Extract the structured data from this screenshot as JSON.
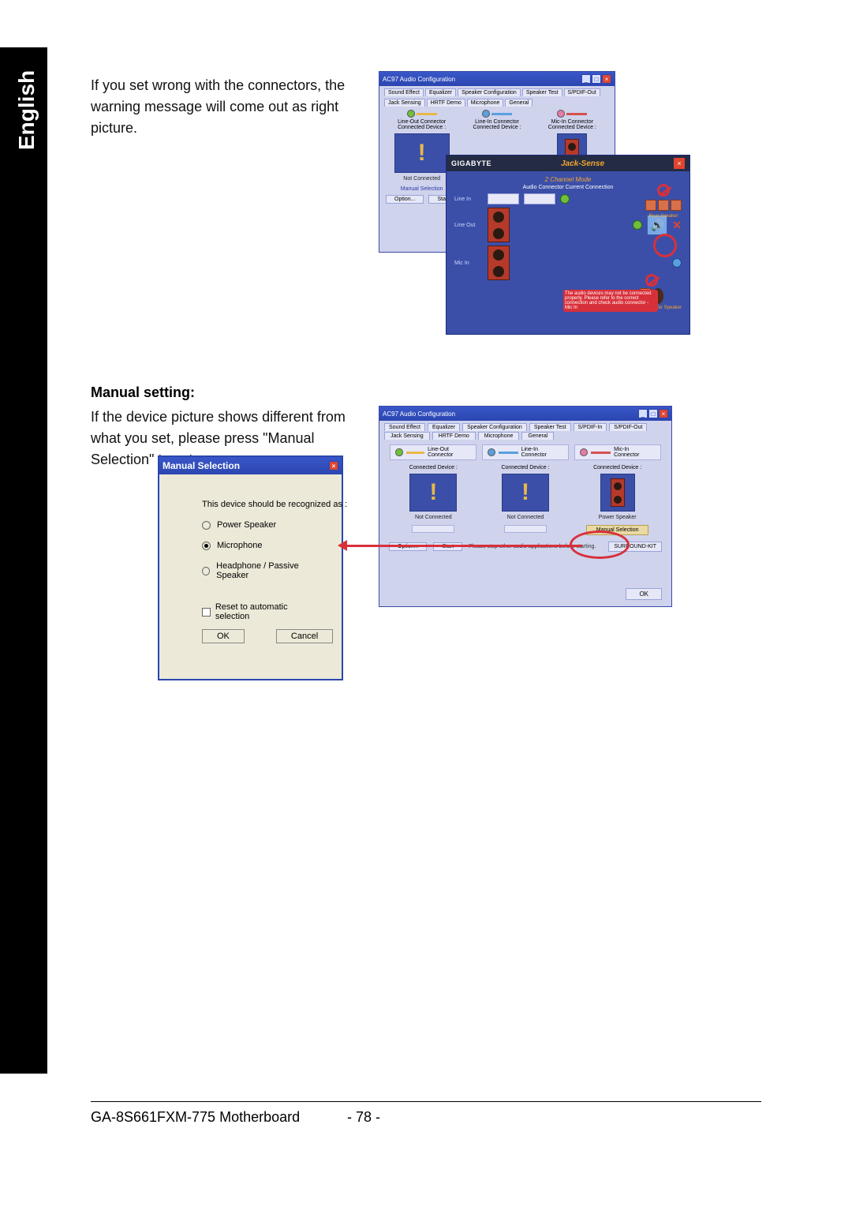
{
  "sidebar": {
    "language": "English"
  },
  "body": {
    "intro": "If you set wrong with the connectors, the warning message will come out as right picture.",
    "manual_heading": "Manual setting:",
    "manual_text": "If the device picture shows different from what you set, please press \"Manual Selection\" to set."
  },
  "shot1": {
    "ac97": {
      "title": "AC97 Audio Configuration",
      "tabs_top": [
        "Sound Effect",
        "Equalizer",
        "Speaker Configuration",
        "Speaker Test",
        "S/PDIF-Out"
      ],
      "tabs_top2": [
        "Jack Sensing",
        "HRTF Demo",
        "Microphone",
        "General"
      ],
      "cols": [
        {
          "name": "Line-Out Connector",
          "cd": "Connected Device :",
          "status": "Not Connected",
          "link": "Manual Selection"
        },
        {
          "name": "Line-In Connector",
          "cd": "Connected Device :",
          "status": "",
          "link": ""
        },
        {
          "name": "Mic-In Connector",
          "cd": "Connected Device :",
          "status": "",
          "link": ""
        }
      ],
      "option_btn": "Option...",
      "start_btn": "Start"
    },
    "jacksense": {
      "brand": "GIGABYTE",
      "title": "Jack-Sense",
      "mode": "2 Channel Mode",
      "header": "Audio Connector    Current Connection",
      "rows": [
        "Line In",
        "Line Out",
        "Mic In"
      ],
      "rear": "Rear Speaker",
      "center": "Center / Subwoofer Speaker",
      "warn": "The audio devices may not be connected properly. Please refer to the correct connection and check audio connector - Mic In"
    }
  },
  "manual": {
    "title": "Manual Selection",
    "prompt": "This device should be recognized as :",
    "options": [
      "Power Speaker",
      "Microphone",
      "Headphone / Passive Speaker"
    ],
    "reset": "Reset to automatic selection",
    "ok": "OK",
    "cancel": "Cancel"
  },
  "shot2": {
    "title": "AC97 Audio Configuration",
    "tabs1": [
      "Sound Effect",
      "Equalizer",
      "Speaker Configuration",
      "Speaker Test",
      "S/PDIF-In",
      "S/PDIF-Out"
    ],
    "tabs2": [
      "Jack Sensing",
      "HRTF Demo",
      "Microphone",
      "General"
    ],
    "cols": [
      {
        "name": "Line-Out Connector",
        "cd": "Connected Device :",
        "status": "Not Connected"
      },
      {
        "name": "Line-In Connector",
        "cd": "Connected Device :",
        "status": "Not Connected"
      },
      {
        "name": "Mic-In Connector",
        "cd": "Connected Device :",
        "status": "Power Speaker",
        "link": "Manual Selection"
      }
    ],
    "option_btn": "Option...",
    "start_btn": "Start",
    "note": "Please stop other audio applications before starting.",
    "surround": "SURROUND-KIT",
    "ok": "OK"
  },
  "footer": {
    "product": "GA-8S661FXM-775 Motherboard",
    "page": "- 78 -"
  }
}
